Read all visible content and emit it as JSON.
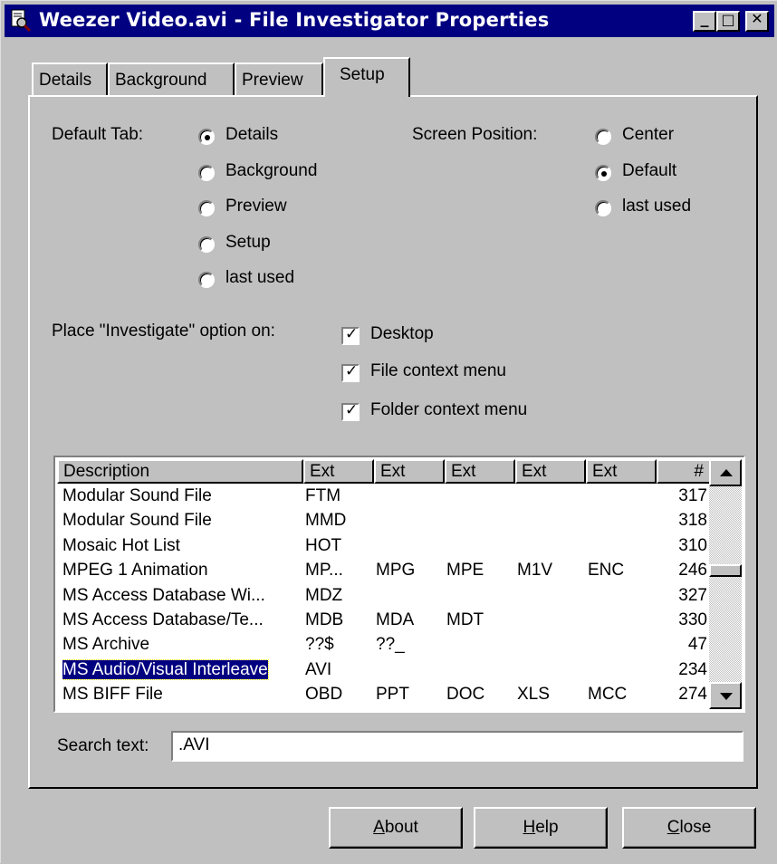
{
  "window": {
    "title": "Weezer Video.avi - File Investigator Properties"
  },
  "title_buttons": {
    "minimize": "_",
    "maximize": "□",
    "close": "✕"
  },
  "tabs": [
    "Details",
    "Background",
    "Preview",
    "Setup"
  ],
  "active_tab": "Setup",
  "setup": {
    "default_tab": {
      "label": "Default Tab:",
      "options": [
        "Details",
        "Background",
        "Preview",
        "Setup",
        "last used"
      ],
      "selected": "Details"
    },
    "screen_position": {
      "label": "Screen Position:",
      "options": [
        "Center",
        "Default",
        "last used"
      ],
      "selected": "Default"
    },
    "place_option": {
      "label": "Place \"Investigate\" option on:",
      "checks": [
        {
          "label": "Desktop",
          "checked": true
        },
        {
          "label": "File context menu",
          "checked": true
        },
        {
          "label": "Folder context menu",
          "checked": true
        }
      ]
    }
  },
  "file_list": {
    "columns": [
      "Description",
      "Ext",
      "Ext",
      "Ext",
      "Ext",
      "Ext",
      "#"
    ],
    "rows": [
      [
        "Modular Sound File",
        "FTM",
        "",
        "",
        "",
        "",
        "317"
      ],
      [
        "Modular Sound File",
        "MMD",
        "",
        "",
        "",
        "",
        "318"
      ],
      [
        "Mosaic Hot List",
        "HOT",
        "",
        "",
        "",
        "",
        "310"
      ],
      [
        "MPEG 1 Animation",
        "MP...",
        "MPG",
        "MPE",
        "M1V",
        "ENC",
        "246"
      ],
      [
        "MS Access Database Wi...",
        "MDZ",
        "",
        "",
        "",
        "",
        "327"
      ],
      [
        "MS Access Database/Te...",
        "MDB",
        "MDA",
        "MDT",
        "",
        "",
        "330"
      ],
      [
        "MS Archive",
        "??$",
        "??_",
        "",
        "",
        "",
        "47"
      ],
      [
        "MS Audio/Visual Interleave",
        "AVI",
        "",
        "",
        "",
        "",
        "234"
      ],
      [
        "MS BIFF File",
        "OBD",
        "PPT",
        "DOC",
        "XLS",
        "MCC",
        "274"
      ]
    ],
    "selected_index": 7
  },
  "search": {
    "label": "Search text:",
    "value": ".AVI"
  },
  "buttons": {
    "about": {
      "hotkey": "A",
      "rest": "bout"
    },
    "help": {
      "hotkey": "H",
      "rest": "elp"
    },
    "close": {
      "hotkey": "C",
      "rest": "lose"
    }
  }
}
